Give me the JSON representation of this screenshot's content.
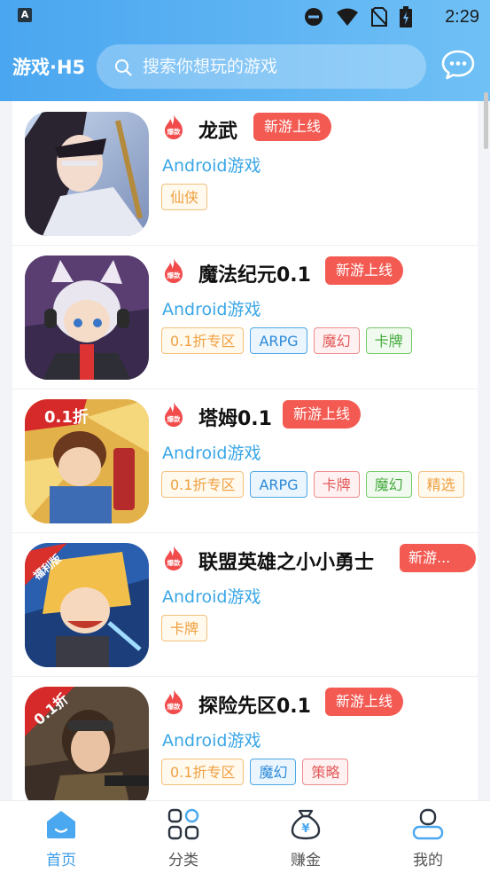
{
  "status_bar": {
    "time": "2:29",
    "app_icon_letter": "A"
  },
  "header": {
    "brand": "游戏·H5",
    "search": {
      "placeholder": "搜索你想玩的游戏",
      "icon": "search-icon"
    },
    "message_icon": "chat-bubble-icon"
  },
  "games": [
    {
      "title": "龙武",
      "badge": "新游上线",
      "platform": "Android游戏",
      "tags": [
        {
          "label": "仙侠",
          "color": "orange"
        }
      ]
    },
    {
      "title": "魔法纪元0.1",
      "badge": "新游上线",
      "platform": "Android游戏",
      "tags": [
        {
          "label": "0.1折专区",
          "color": "orange"
        },
        {
          "label": "ARPG",
          "color": "blue"
        },
        {
          "label": "魔幻",
          "color": "red"
        },
        {
          "label": "卡牌",
          "color": "green"
        }
      ]
    },
    {
      "title": "塔姆0.1",
      "badge": "新游上线",
      "platform": "Android游戏",
      "tags": [
        {
          "label": "0.1折专区",
          "color": "orange"
        },
        {
          "label": "ARPG",
          "color": "blue"
        },
        {
          "label": "卡牌",
          "color": "red"
        },
        {
          "label": "魔幻",
          "color": "green"
        },
        {
          "label": "精选",
          "color": "orange"
        }
      ]
    },
    {
      "title": "联盟英雄之小小勇士",
      "badge": "新游...",
      "platform": "Android游戏",
      "tags": [
        {
          "label": "卡牌",
          "color": "orange"
        }
      ]
    },
    {
      "title": "探险先区0.1",
      "badge": "新游上线",
      "platform": "Android游戏",
      "tags": [
        {
          "label": "0.1折专区",
          "color": "orange"
        },
        {
          "label": "魔幻",
          "color": "blue"
        },
        {
          "label": "策略",
          "color": "red"
        }
      ]
    }
  ],
  "fire_badge_text": "爆款",
  "cover_labels": {
    "game3": "0.1折",
    "game4": "福利版",
    "game5": "0.1折"
  },
  "tabbar": [
    {
      "label": "首页",
      "icon": "home-icon",
      "active": true
    },
    {
      "label": "分类",
      "icon": "grid-icon",
      "active": false
    },
    {
      "label": "赚金",
      "icon": "money-bag-icon",
      "active": false
    },
    {
      "label": "我的",
      "icon": "profile-icon",
      "active": false
    }
  ],
  "colors": {
    "accent": "#3b9be6",
    "header_start": "#4aa6f0",
    "header_end": "#6fc0f5",
    "badge_red": "#f35a52"
  }
}
